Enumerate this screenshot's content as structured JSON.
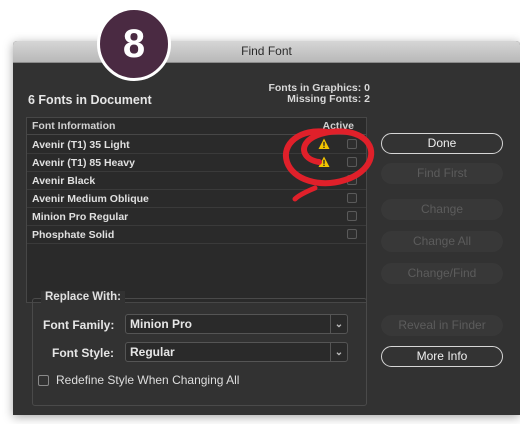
{
  "step_badge": "8",
  "window": {
    "title": "Find Font"
  },
  "summary": {
    "doc_count": "6 Fonts in Document",
    "graphics_line": "Fonts in Graphics: 0",
    "missing_line": "Missing Fonts: 2"
  },
  "table": {
    "col_info": "Font Information",
    "col_active": "Active",
    "rows": [
      {
        "name": "Avenir (T1) 35 Light",
        "warning": true
      },
      {
        "name": "Avenir (T1) 85 Heavy",
        "warning": true
      },
      {
        "name": "Avenir Black",
        "warning": false
      },
      {
        "name": "Avenir Medium Oblique",
        "warning": false
      },
      {
        "name": "Minion Pro Regular",
        "warning": false
      },
      {
        "name": "Phosphate Solid",
        "warning": false
      }
    ]
  },
  "buttons": {
    "done": "Done",
    "find_first": "Find First",
    "change": "Change",
    "change_all": "Change All",
    "change_find": "Change/Find",
    "reveal_in_finder": "Reveal in Finder",
    "more_info": "More Info"
  },
  "replace": {
    "section_label": "Replace With:",
    "font_family_label": "Font Family:",
    "font_family_value": "Minion Pro",
    "font_style_label": "Font Style:",
    "font_style_value": "Regular",
    "redefine_label": "Redefine Style When Changing All",
    "redefine_checked": false
  },
  "colors": {
    "dialog_bg": "#323232",
    "badge_bg": "#4a2a42",
    "warning": "#f2c500",
    "annotation_red": "#e0202a"
  },
  "icons": {
    "warning": "warning-triangle-icon",
    "dropdown": "chevron-down-icon"
  }
}
